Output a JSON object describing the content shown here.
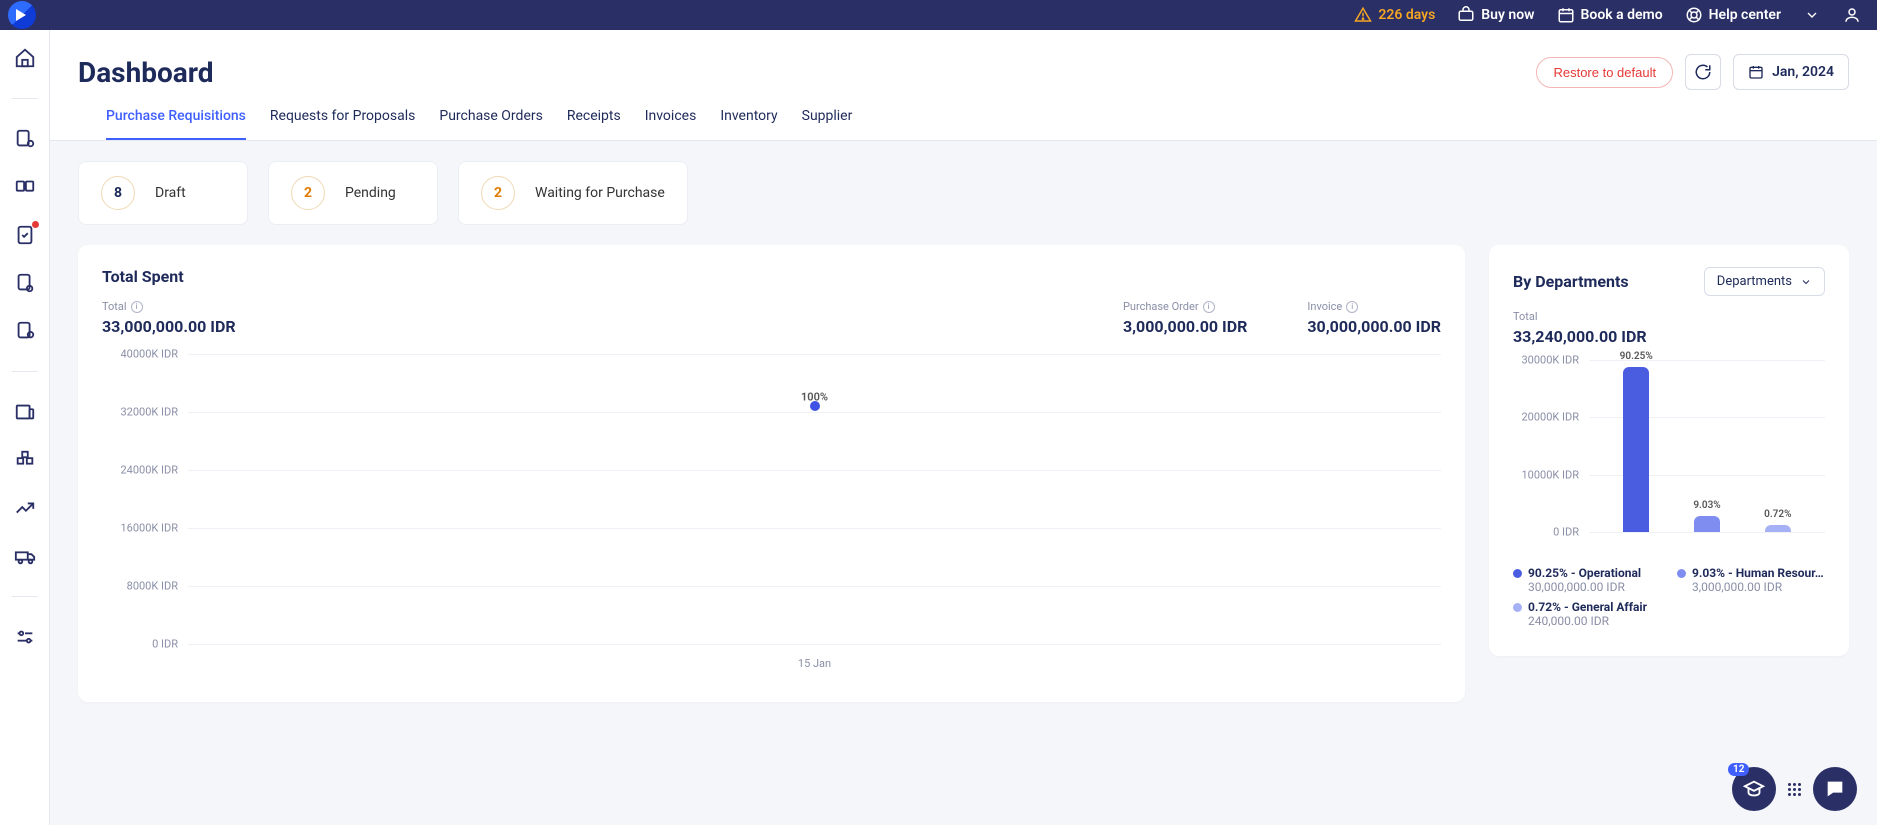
{
  "topbar": {
    "trial": "226 days",
    "buy": "Buy now",
    "demo": "Book a demo",
    "help": "Help center"
  },
  "page": {
    "title": "Dashboard",
    "restore": "Restore to default",
    "date": "Jan, 2024"
  },
  "tabs": [
    "Purchase Requisitions",
    "Requests for Proposals",
    "Purchase Orders",
    "Receipts",
    "Invoices",
    "Inventory",
    "Supplier"
  ],
  "status_cards": [
    {
      "count": "8",
      "label": "Draft",
      "orange": false
    },
    {
      "count": "2",
      "label": "Pending",
      "orange": true
    },
    {
      "count": "2",
      "label": "Waiting for Purchase",
      "orange": true
    }
  ],
  "total_spent": {
    "title": "Total Spent",
    "metrics": [
      {
        "label": "Total",
        "value": "33,000,000.00 IDR"
      },
      {
        "label": "Purchase Order",
        "value": "3,000,000.00 IDR"
      },
      {
        "label": "Invoice",
        "value": "30,000,000.00 IDR"
      }
    ],
    "y_ticks": [
      "40000K IDR",
      "32000K IDR",
      "24000K IDR",
      "16000K IDR",
      "8000K IDR",
      "0 IDR"
    ],
    "x_tick": "15 Jan",
    "point_label": "100%"
  },
  "departments": {
    "title": "By Departments",
    "select": "Departments",
    "total_label": "Total",
    "total_value": "33,240,000.00 IDR",
    "y_ticks": [
      "30000K IDR",
      "20000K IDR",
      "10000K IDR",
      "0 IDR"
    ],
    "bars": [
      {
        "pct": "90.25%",
        "color": "#4a5de0",
        "h": 100
      },
      {
        "pct": "9.03%",
        "color": "#7f8df0",
        "h": 10
      },
      {
        "pct": "0.72%",
        "color": "#a6b1f5",
        "h": 4
      }
    ],
    "legend": [
      {
        "color": "#4a5de0",
        "name": "90.25% - Operational",
        "amount": "30,000,000.00 IDR"
      },
      {
        "color": "#7f8df0",
        "name": "9.03% - Human Resour…",
        "amount": "3,000,000.00 IDR"
      },
      {
        "color": "#a6b1f5",
        "name": "0.72% - General Affair",
        "amount": "240,000.00 IDR"
      }
    ]
  },
  "fab_count": "12",
  "chart_data": [
    {
      "type": "scatter",
      "title": "Total Spent",
      "x": [
        "15 Jan"
      ],
      "series": [
        {
          "name": "Total",
          "values": [
            33000000
          ],
          "labels": [
            "100%"
          ]
        }
      ],
      "ylabel": "IDR",
      "ylim": [
        0,
        40000000
      ],
      "y_ticks": [
        0,
        8000000,
        16000000,
        24000000,
        32000000,
        40000000
      ]
    },
    {
      "type": "bar",
      "title": "By Departments",
      "categories": [
        "Operational",
        "Human Resources",
        "General Affair"
      ],
      "values": [
        30000000,
        3000000,
        240000
      ],
      "percentages": [
        90.25,
        9.03,
        0.72
      ],
      "colors": [
        "#4a5de0",
        "#7f8df0",
        "#a6b1f5"
      ],
      "ylabel": "IDR",
      "ylim": [
        0,
        30000000
      ],
      "y_ticks": [
        0,
        10000000,
        20000000,
        30000000
      ],
      "total": 33240000
    }
  ]
}
